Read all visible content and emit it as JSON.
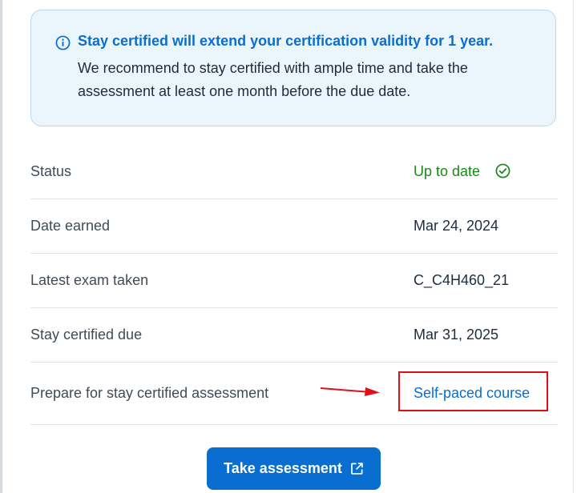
{
  "info": {
    "title": "Stay certified will extend your certification validity for 1 year.",
    "body": "We recommend to stay certified with ample time and take the assessment at least one month before the due date.",
    "icon": "info-icon"
  },
  "details": [
    {
      "label": "Status",
      "value": "Up to date"
    },
    {
      "label": "Date earned",
      "value": "Mar 24, 2024"
    },
    {
      "label": "Latest exam taken",
      "value": "C_C4H460_21"
    },
    {
      "label": "Stay certified due",
      "value": "Mar 31, 2025"
    },
    {
      "label": "Prepare for stay certified assessment",
      "value": "Self-paced course"
    }
  ],
  "status_icon": "check-circle-icon",
  "button": {
    "label": "Take assessment",
    "icon": "external-link-icon"
  },
  "colors": {
    "accent": "#0a6ed1",
    "success": "#188918",
    "info_bg": "#eaf5fc",
    "annotation": "#e0101a"
  }
}
